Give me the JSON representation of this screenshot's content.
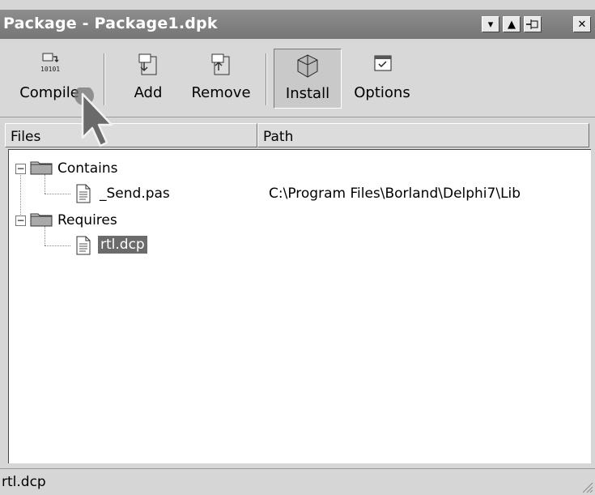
{
  "window": {
    "title": "Package - Package1.dpk"
  },
  "titlebar_buttons": [
    {
      "name": "dropdown-button",
      "glyph": "▾"
    },
    {
      "name": "maximize-button",
      "glyph": "▲"
    },
    {
      "name": "pin-button",
      "glyph": "⊣"
    },
    {
      "name": "close-button",
      "glyph": "✕"
    }
  ],
  "toolbar": {
    "compile_label": "Compile",
    "add_label": "Add",
    "remove_label": "Remove",
    "install_label": "Install",
    "options_label": "Options"
  },
  "columns": {
    "files": "Files",
    "path": "Path"
  },
  "tree": {
    "contains_label": "Contains",
    "contains_file": "_Send.pas",
    "contains_path": "C:\\Program Files\\Borland\\Delphi7\\Lib",
    "requires_label": "Requires",
    "requires_file": "rtl.dcp"
  },
  "status": {
    "text": "rtl.dcp"
  }
}
